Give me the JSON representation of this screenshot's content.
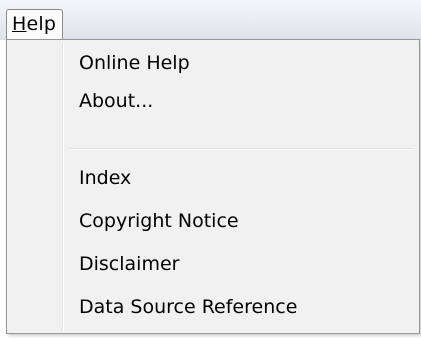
{
  "menubar": {
    "help_label": "Help",
    "help_accelerator": "H",
    "help_rest": "elp"
  },
  "menu": {
    "group1": [
      {
        "label": "Online Help"
      },
      {
        "label": "About..."
      }
    ],
    "group2": [
      {
        "label": "Index"
      },
      {
        "label": "Copyright Notice"
      },
      {
        "label": "Disclaimer"
      },
      {
        "label": "Data Source Reference"
      }
    ]
  }
}
